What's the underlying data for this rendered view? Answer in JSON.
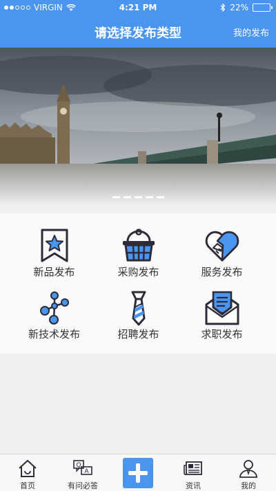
{
  "status_bar": {
    "carrier": "VIRGIN",
    "time": "4:21 PM",
    "battery": "22%",
    "battery_level": 0.22
  },
  "nav": {
    "title": "请选择发布类型",
    "right_link": "我的发布"
  },
  "banner": {
    "image": "London Westminster Bridge and Big Ben",
    "slide_count": 5
  },
  "categories": [
    {
      "label": "新品发布",
      "icon": "new-product-ribbon-icon"
    },
    {
      "label": "采购发布",
      "icon": "shopping-basket-icon"
    },
    {
      "label": "服务发布",
      "icon": "handshake-heart-icon"
    },
    {
      "label": "新技术发布",
      "icon": "molecule-icon"
    },
    {
      "label": "招聘发布",
      "icon": "necktie-icon"
    },
    {
      "label": "求职发布",
      "icon": "envelope-letter-icon"
    }
  ],
  "tabbar": {
    "items": [
      {
        "label": "首页",
        "icon": "home-icon"
      },
      {
        "label": "有问必答",
        "icon": "qa-chat-icon"
      },
      {
        "label": "",
        "icon": "plus-icon"
      },
      {
        "label": "资讯",
        "icon": "newspaper-icon"
      },
      {
        "label": "我的",
        "icon": "user-icon"
      }
    ]
  },
  "colors": {
    "primary": "#4a95f0",
    "icon_dark": "#2b2b3a",
    "icon_blue": "#4a95f0"
  }
}
